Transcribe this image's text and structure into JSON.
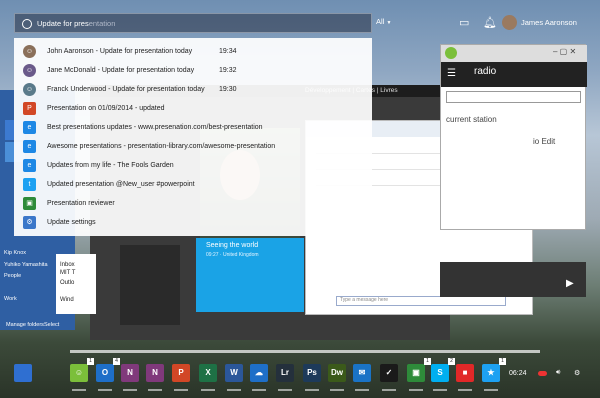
{
  "search": {
    "query_typed": "Update for pres",
    "query_hint": "entation",
    "filter": "All"
  },
  "user": {
    "name": "James Aaronson"
  },
  "results": [
    {
      "icon": "person",
      "color": "#8a6f5a",
      "text": "John Aaronson - Update for presentation today",
      "time": "19:34"
    },
    {
      "icon": "person",
      "color": "#6a5a8a",
      "text": "Jane McDonald - Update for presentation today",
      "time": "19:32"
    },
    {
      "icon": "person",
      "color": "#5a7a8a",
      "text": "Franck Underwood - Update for presentation today",
      "time": "19:30"
    },
    {
      "icon": "powerpoint",
      "color": "#d24726",
      "text": "Presentation on 01/09/2014 - updated",
      "time": ""
    },
    {
      "icon": "ie",
      "color": "#1e88e5",
      "text": "Best presentations updates - www.presenation.com/best-presentation",
      "time": ""
    },
    {
      "icon": "ie",
      "color": "#1e88e5",
      "text": "Awesome presentations - presentation-library.com/awesome-presentation",
      "time": ""
    },
    {
      "icon": "ie",
      "color": "#1e88e5",
      "text": "Updates from my life - The Fools Garden",
      "time": ""
    },
    {
      "icon": "twitter",
      "color": "#1da1f2",
      "text": "Updated presentation @New_user #powerpoint",
      "time": ""
    },
    {
      "icon": "store",
      "color": "#2e8b3a",
      "text": "Presentation reviewer",
      "time": ""
    },
    {
      "icon": "settings",
      "color": "#3b77c9",
      "text": "Update settings",
      "time": ""
    }
  ],
  "background": {
    "lib_nav": "Développement | Cartes | Livres",
    "radio_title": "radio",
    "radio_station": "current station",
    "radio_edit": "io Edit",
    "chat_input": "Type a message here",
    "chat_badge": "2",
    "photo_caption": "Seeing the world",
    "photo_sub": "09:27 · United Kingdom",
    "start_items": [
      "Kip Knox",
      "Yuhiko Yamashita",
      "People",
      "Work"
    ],
    "start_bottom": [
      "Manage folders",
      "Select"
    ],
    "mid_list": [
      "Inbox",
      "MIT T",
      "Outlo",
      "Wind"
    ]
  },
  "taskbar": {
    "time": "06:24",
    "apps": [
      {
        "name": "windows",
        "color": "#2f6fd1",
        "label": ""
      },
      {
        "name": "messaging",
        "color": "#7bbf3a",
        "label": "☺",
        "badge": "1"
      },
      {
        "name": "outlook",
        "color": "#1e6fc8",
        "label": "O",
        "badge": "4"
      },
      {
        "name": "onenote",
        "color": "#80397b",
        "label": "N"
      },
      {
        "name": "onenote-2",
        "color": "#80397b",
        "label": "N"
      },
      {
        "name": "powerpoint",
        "color": "#d24726",
        "label": "P"
      },
      {
        "name": "excel",
        "color": "#1e7145",
        "label": "X"
      },
      {
        "name": "word",
        "color": "#2b579a",
        "label": "W"
      },
      {
        "name": "onedrive",
        "color": "#1e6fc8",
        "label": "☁"
      },
      {
        "name": "lightroom",
        "color": "#24303c",
        "label": "Lr"
      },
      {
        "name": "photoshop",
        "color": "#1d3a5a",
        "label": "Ps"
      },
      {
        "name": "dreamweaver",
        "color": "#3b5a1a",
        "label": "Dw"
      },
      {
        "name": "mail",
        "color": "#1a73c6",
        "label": "✉"
      },
      {
        "name": "metro",
        "color": "#1a1a1a",
        "label": "✓"
      },
      {
        "name": "store",
        "color": "#2e8b3a",
        "label": "▣",
        "badge": "1"
      },
      {
        "name": "skype",
        "color": "#00aff0",
        "label": "S",
        "badge": "2"
      },
      {
        "name": "flipboard",
        "color": "#e12828",
        "label": "■"
      },
      {
        "name": "twitter",
        "color": "#1da1f2",
        "label": "★",
        "badge": "1"
      }
    ]
  }
}
